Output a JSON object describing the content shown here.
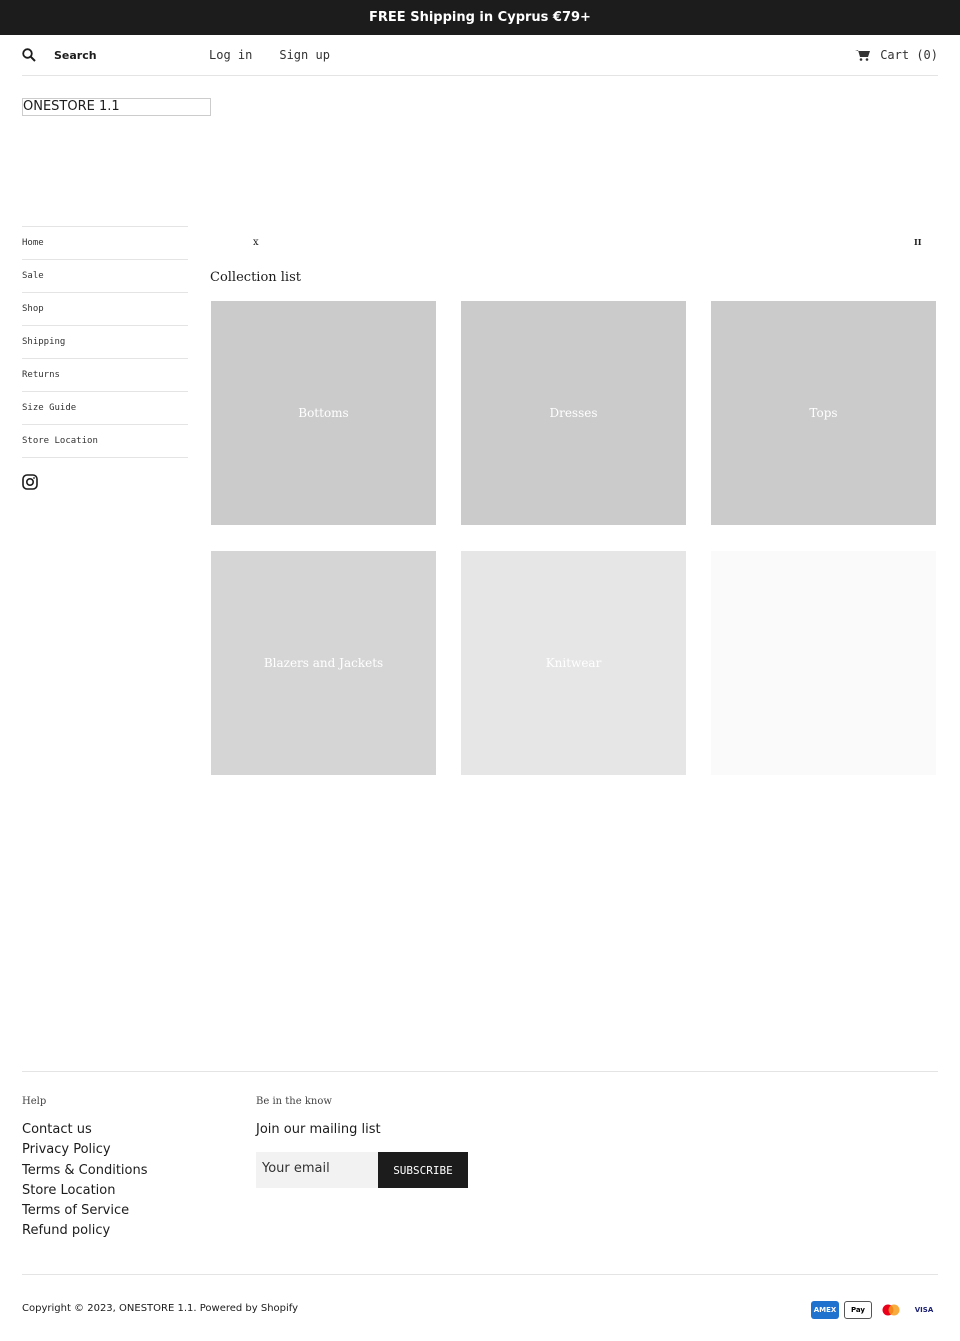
{
  "announcement": "FREE Shipping in Cyprus €79+",
  "header": {
    "search_label": "Search",
    "login": "Log in",
    "signup": "Sign up",
    "cart": "Cart (0)"
  },
  "logo": "ONESTORE 1.1",
  "nav": [
    "Home",
    "Sale",
    "Shop",
    "Shipping",
    "Returns",
    "Size Guide",
    "Store Location"
  ],
  "slideshow": {
    "prev": "x",
    "pause": "II"
  },
  "collection": {
    "title": "Collection list",
    "items": [
      {
        "label": "Bottoms",
        "color": "#cbcbcb"
      },
      {
        "label": "Dresses",
        "color": "#cbcbcb"
      },
      {
        "label": "Tops",
        "color": "#cbcbcb"
      },
      {
        "label": "Blazers and Jackets",
        "color": "#d5d5d5"
      },
      {
        "label": "Knitwear",
        "color": "#e6e6e6"
      },
      {
        "label": "",
        "color": "#fafafa"
      }
    ]
  },
  "footer": {
    "help_heading": "Help",
    "links": [
      "Contact us",
      "Privacy Policy",
      "Terms & Conditions",
      "Store Location",
      "Terms of Service",
      "Refund policy"
    ],
    "news_heading": "Be in the know",
    "mailing": "Join our mailing list",
    "email_placeholder": "Your email",
    "subscribe": "SUBSCRIBE",
    "copyright": "Copyright © 2023, ONESTORE 1.1. Powered by Shopify",
    "payments": [
      "AMEX",
      "Pay",
      "",
      "VISA"
    ]
  }
}
